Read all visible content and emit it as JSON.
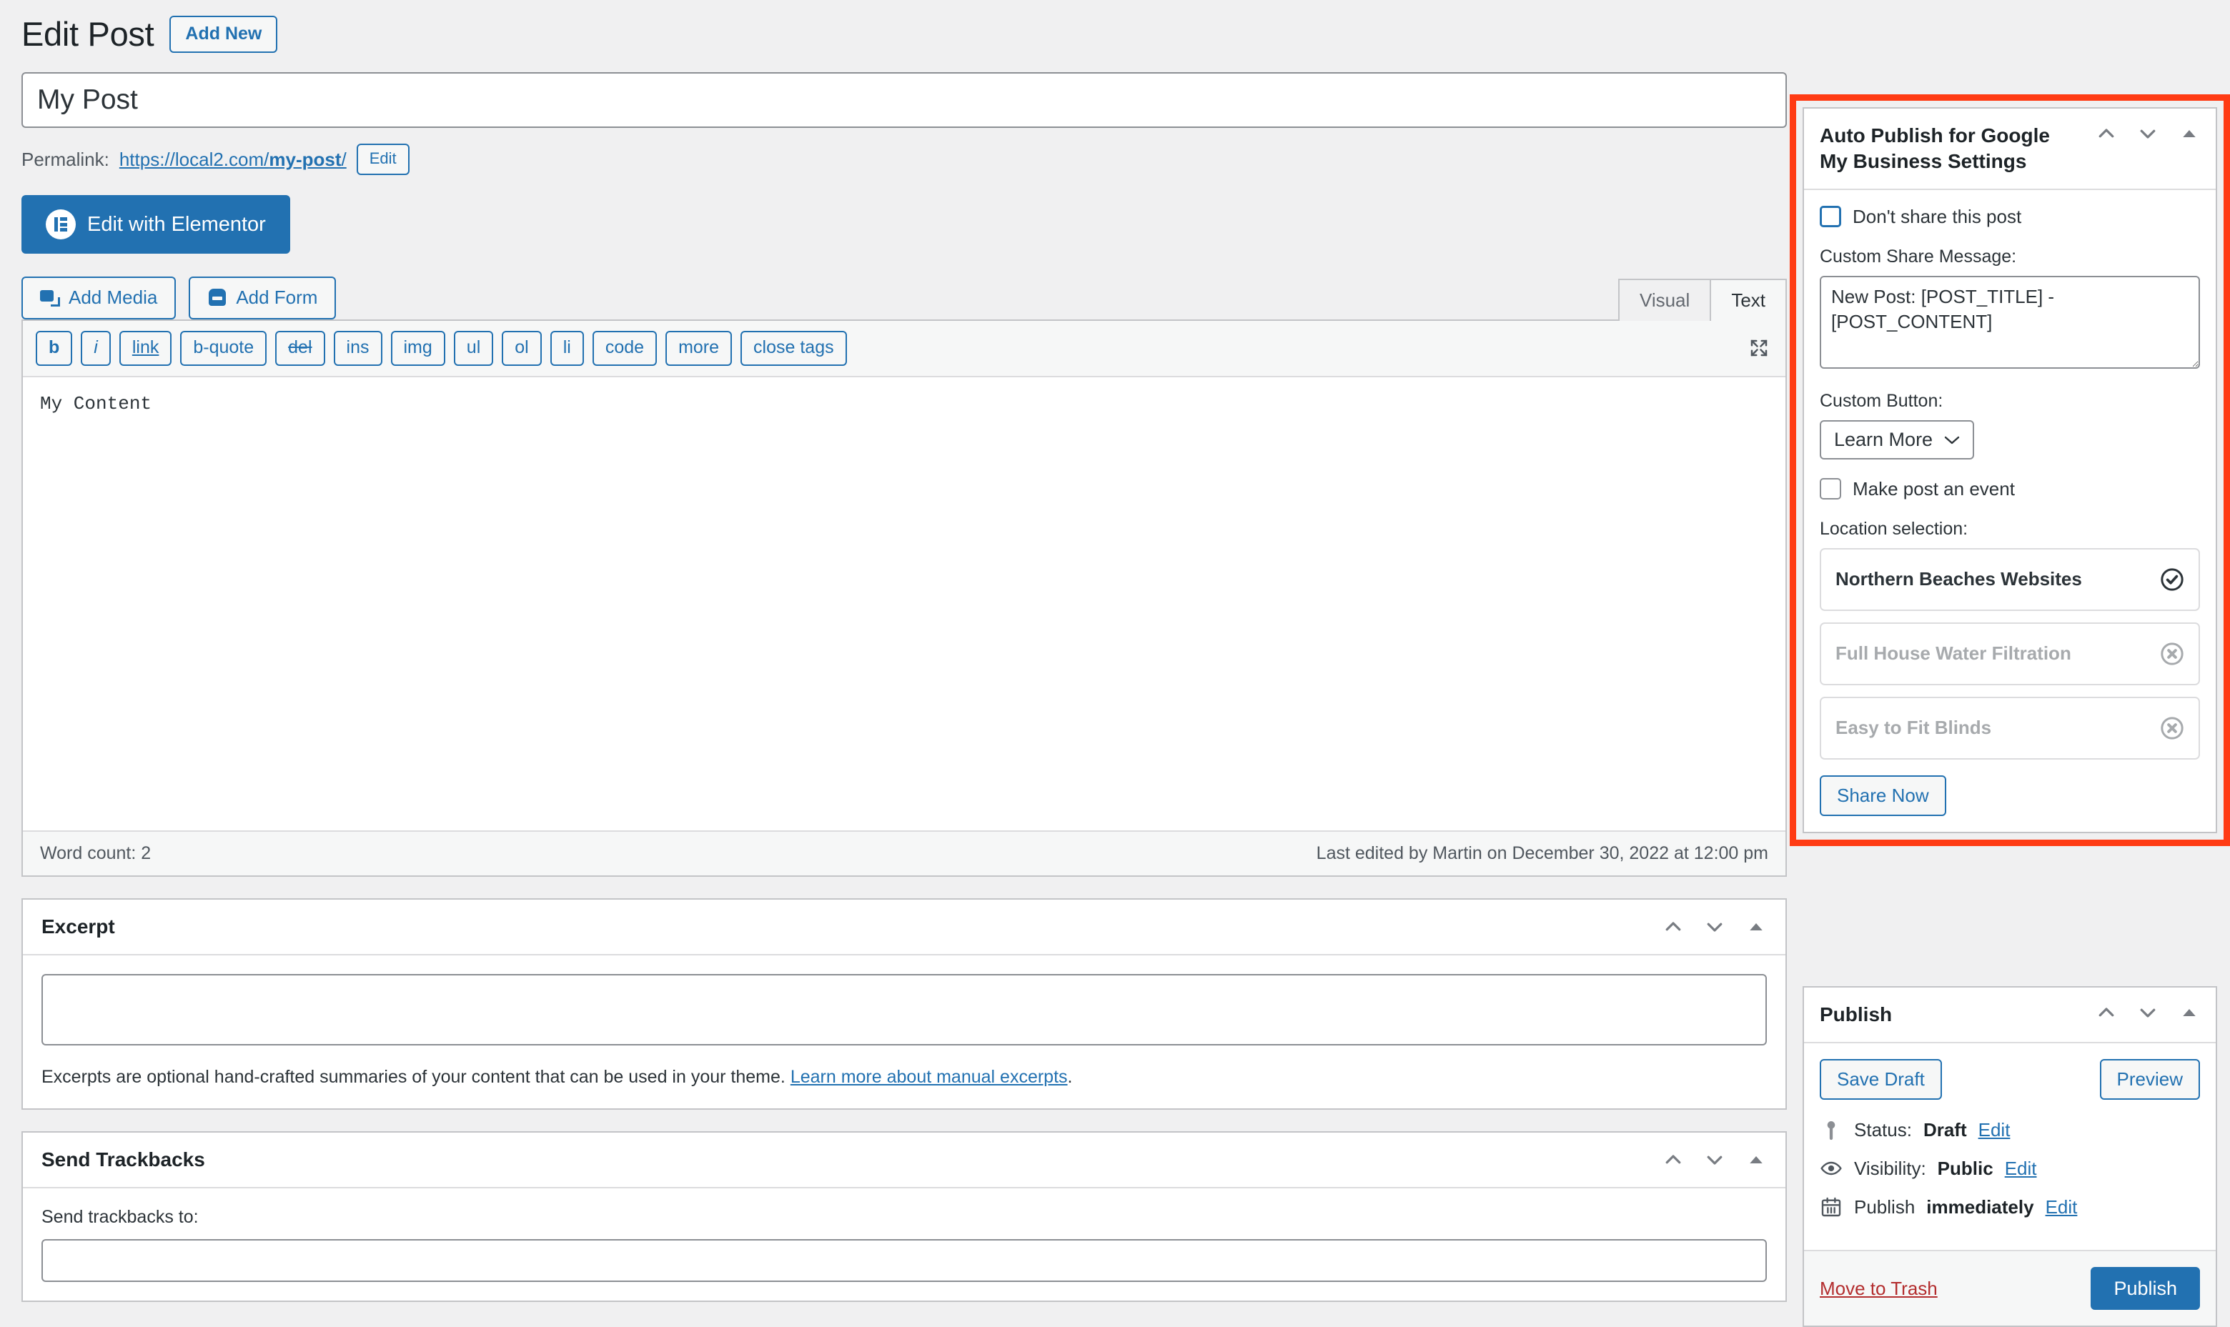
{
  "header": {
    "title": "Edit Post",
    "add_new_label": "Add New"
  },
  "post": {
    "title_value": "My Post",
    "permalink_label": "Permalink:",
    "permalink_url": "https://local2.com/",
    "permalink_slug": "my-post",
    "permalink_trailing": "/",
    "permalink_edit_label": "Edit",
    "content": "My Content"
  },
  "elementor": {
    "label": "Edit with Elementor"
  },
  "media_buttons": {
    "add_media": "Add Media",
    "add_form": "Add Form"
  },
  "editor_tabs": {
    "visual": "Visual",
    "text": "Text",
    "active": "Text"
  },
  "quicktags": [
    "b",
    "i",
    "link",
    "b-quote",
    "del",
    "ins",
    "img",
    "ul",
    "ol",
    "li",
    "code",
    "more",
    "close tags"
  ],
  "editor_footer": {
    "word_count": "Word count: 2",
    "last_edited": "Last edited by Martin on December 30, 2022 at 12:00 pm"
  },
  "excerpt": {
    "title": "Excerpt",
    "value": "",
    "helper_prefix": "Excerpts are optional hand-crafted summaries of your content that can be used in your theme.",
    "helper_link": "Learn more about manual excerpts",
    "helper_suffix": "."
  },
  "trackbacks": {
    "title": "Send Trackbacks",
    "field_label": "Send trackbacks to:",
    "value": ""
  },
  "gmb": {
    "title": "Auto Publish for Google My Business Settings",
    "dont_share_label": "Don't share this post",
    "dont_share_checked": false,
    "custom_share_label": "Custom Share Message:",
    "custom_share_value": "New Post: [POST_TITLE] - [POST_CONTENT]",
    "custom_button_label": "Custom Button:",
    "custom_button_value": "Learn More",
    "make_event_label": "Make post an event",
    "make_event_checked": false,
    "location_label": "Location selection:",
    "locations": [
      {
        "name": "Northern Beaches Websites",
        "state": "selected",
        "icon": "check-circle-icon"
      },
      {
        "name": "Full House Water Filtration",
        "state": "disabled",
        "icon": "x-circle-icon"
      },
      {
        "name": "Easy to Fit Blinds",
        "state": "disabled",
        "icon": "x-circle-icon"
      }
    ],
    "share_now_label": "Share Now",
    "highlight_color": "#ff3b14"
  },
  "publish": {
    "title": "Publish",
    "save_draft_label": "Save Draft",
    "preview_label": "Preview",
    "status_prefix": "Status:",
    "status_value": "Draft",
    "status_edit": "Edit",
    "visibility_prefix": "Visibility:",
    "visibility_value": "Public",
    "visibility_edit": "Edit",
    "schedule_prefix": "Publish",
    "schedule_value": "immediately",
    "schedule_edit": "Edit",
    "trash_label": "Move to Trash",
    "publish_label": "Publish"
  }
}
